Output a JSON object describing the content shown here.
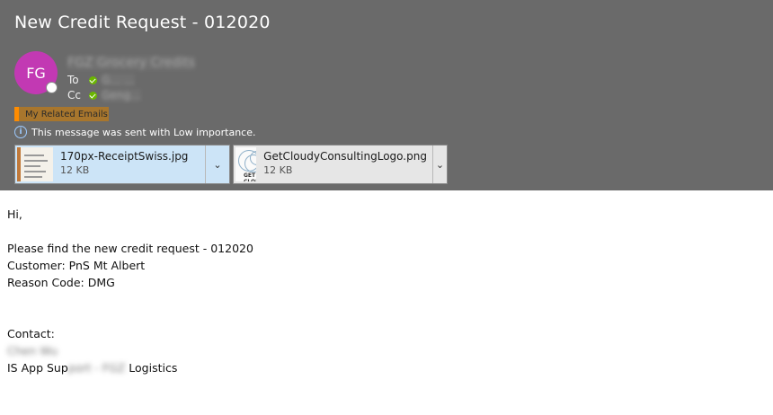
{
  "email": {
    "subject": "New Credit Request - 012020",
    "avatar_initials": "FG",
    "sender_name": "FGZ Grocery Credits",
    "to_label": "To",
    "to_name": "G… …",
    "cc_label": "Cc",
    "cc_name": "Geng…",
    "category_tag": "My Related Emails",
    "importance_notice": "This message was sent with Low importance.",
    "attachments": [
      {
        "name": "170px-ReceiptSwiss.jpg",
        "size": "12 KB"
      },
      {
        "name": "GetCloudyConsultingLogo.png",
        "size": "12 KB",
        "thumb_text": "GET CLOU"
      }
    ],
    "body": {
      "greeting": "Hi,",
      "line1": "Please find the new credit request - 012020",
      "line2": "Customer: PnS Mt Albert",
      "line3": "Reason Code: DMG",
      "contact_label": "Contact:",
      "contact_name": "Chen Wu",
      "contact_role_start": "IS App Sup",
      "contact_role_redacted": "port - FGZ",
      "contact_role_end": " Logistics"
    }
  },
  "colors": {
    "header_bg": "#6a6a6a",
    "avatar_bg": "#c239b3",
    "tag_accent": "#ff8c00",
    "attachment_selected_bg": "#cce4f7"
  },
  "icons": [
    "presence-icon",
    "check-icon",
    "info-icon",
    "chevron-down-icon"
  ]
}
